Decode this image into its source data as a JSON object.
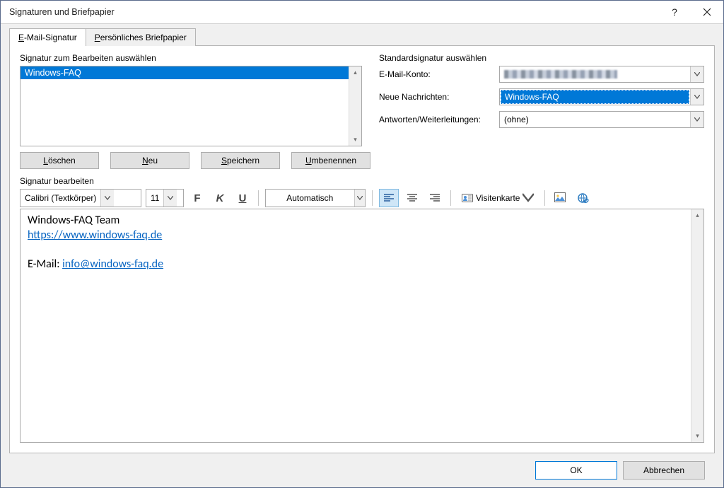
{
  "window": {
    "title": "Signaturen und Briefpapier"
  },
  "tabs": {
    "email_pre": "E",
    "email_rest": "-Mail-Signatur",
    "stationery_pre": "P",
    "stationery_rest": "ersönliches Briefpapier"
  },
  "left": {
    "label": "Signatur zum Bearbeiten auswählen",
    "items": [
      "Windows-FAQ"
    ],
    "buttons": {
      "delete_pre": "L",
      "delete_rest": "öschen",
      "new_pre": "N",
      "new_rest": "eu",
      "save_pre": "S",
      "save_rest": "peichern",
      "rename_pre": "U",
      "rename_rest": "mbenennen"
    }
  },
  "right": {
    "label": "Standardsignatur auswählen",
    "account_pre": "K",
    "account_label_pre": "E-Mail-",
    "account_rest": "onto:",
    "account_value": "",
    "new_pre": "r",
    "new_label_pre": "Neue Nach",
    "new_rest": "ichten:",
    "new_value": "Windows-FAQ",
    "reply_pre": "W",
    "reply_label_pre": "Antworten/",
    "reply_rest": "eiterleitungen:",
    "reply_value": "(ohne)"
  },
  "editor": {
    "label": "Signatur bearbeiten",
    "font": "Calibri (Textkörper)",
    "size": "11",
    "color": "Automatisch",
    "vcard": "Visitenkarte",
    "content": {
      "line1": "Windows-FAQ Team",
      "url": "https://www.windows-faq.de",
      "line3_prefix": "E-Mail: ",
      "email": "info@windows-faq.de"
    }
  },
  "footer": {
    "ok": "OK",
    "cancel": "Abbrechen"
  }
}
